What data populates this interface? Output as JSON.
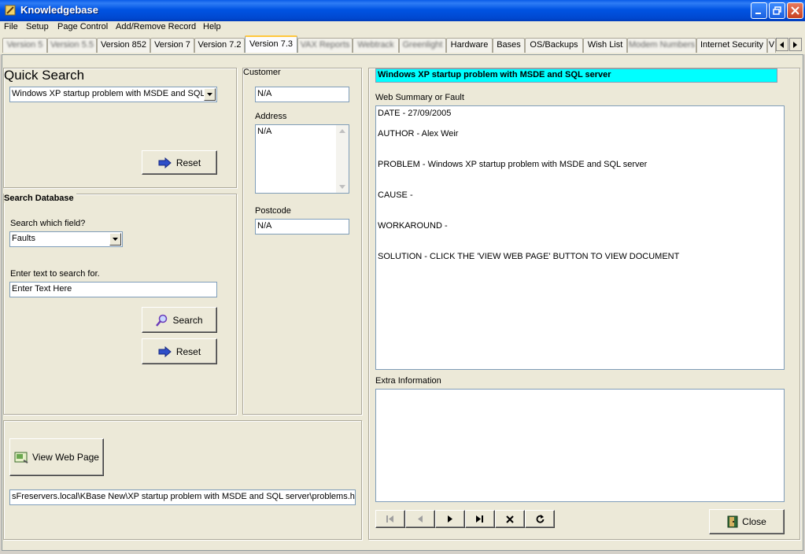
{
  "window": {
    "title": "Knowledgebase"
  },
  "menu": [
    {
      "label": "File"
    },
    {
      "label": "Setup"
    },
    {
      "label": "Page Control"
    },
    {
      "label": "Add/Remove Record"
    },
    {
      "label": "Help"
    }
  ],
  "tabs": {
    "blurred_1": "Version 5",
    "blurred_2": "Version 5.5",
    "version_852": "Version 852",
    "version_7": "Version 7",
    "version_72": "Version 7.2",
    "version_73": "Version 7.3",
    "blurred_3": "VAX Reports",
    "blurred_4": "Webtrack",
    "blurred_5": "Greenlight",
    "hardware": "Hardware",
    "bases": "Bases",
    "os_backups": "OS/Backups",
    "wish_list": "Wish List",
    "blurred_6": "Modem Numbers",
    "internet_security": "Internet Security",
    "overflow": "V"
  },
  "quick_search": {
    "heading": "Quick Search",
    "selected": "Windows XP startup problem with MSDE and SQL",
    "reset_label": "Reset"
  },
  "search_db": {
    "heading": "Search Database",
    "field_label": "Search which field?",
    "field_value": "Faults",
    "text_label": "Enter text to search for.",
    "text_value": "Enter Text Here",
    "search_label": "Search",
    "reset_label": "Reset"
  },
  "customer": {
    "label": "Customer",
    "value": "N/A",
    "address_label": "Address",
    "address_value": "N/A",
    "postcode_label": "Postcode",
    "postcode_value": "N/A"
  },
  "web": {
    "button_label": "View Web Page",
    "path": "sFreservers.local\\KBase New\\XP startup problem with MSDE and SQL server\\problems.htm"
  },
  "record": {
    "title": "Windows XP startup problem with MSDE and SQL server",
    "summary_label": "Web Summary or Fault",
    "summary_lines": {
      "date": "DATE - 27/09/2005",
      "author": "AUTHOR - Alex Weir",
      "problem": "PROBLEM - Windows XP startup problem with MSDE and SQL server",
      "cause": "CAUSE -",
      "workaround": "WORKAROUND -",
      "solution": "SOLUTION - CLICK THE 'VIEW WEB PAGE' BUTTON TO VIEW DOCUMENT"
    },
    "extra_label": "Extra Information",
    "extra_value": ""
  },
  "close_label": "Close",
  "colors": {
    "title_highlight": "#00ffff",
    "titlebar": "#0054e3"
  }
}
